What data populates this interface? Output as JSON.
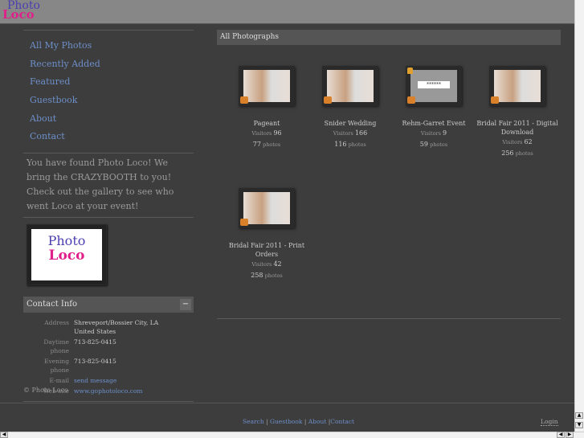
{
  "logo": {
    "line1": "Photo",
    "line2": "Loco"
  },
  "nav": [
    "All My Photos",
    "Recently Added",
    "Featured",
    "Guestbook",
    "About",
    "Contact"
  ],
  "blurb": "You have found Photo Loco! We bring the CRAZYBOOTH to you! Check out the gallery to see who went Loco at your event!",
  "contact": {
    "title": "Contact Info",
    "collapse": "−",
    "rows": [
      {
        "k": "Address",
        "v": "Shreveport/Bossier City, LA",
        "v2": "United States"
      },
      {
        "k": "Daytime phone",
        "v": "713-825-0415"
      },
      {
        "k": "Evening phone",
        "v": "713-825-0415"
      },
      {
        "k": "E-mail",
        "v": "send message"
      },
      {
        "k": "Web site",
        "v": "www.gophotoloco.com"
      }
    ]
  },
  "copyright": "© Photo Loco",
  "main": {
    "title": "All Photographs",
    "visitors_label": "Visitors",
    "photos_label": "photos",
    "albums": [
      {
        "title": "Pageant",
        "visitors": "96",
        "photos": "77",
        "locked": false
      },
      {
        "title": "Snider Wedding",
        "visitors": "166",
        "photos": "116",
        "locked": false
      },
      {
        "title": "Rehm-Garret Event",
        "visitors": "9",
        "photos": "59",
        "locked": true
      },
      {
        "title": "Bridal Fair 2011 - Digital Download",
        "visitors": "62",
        "photos": "256",
        "locked": false
      },
      {
        "title": "Bridal Fair 2011 - Print Orders",
        "visitors": "42",
        "photos": "258",
        "locked": false
      }
    ]
  },
  "footer": {
    "links": [
      "Search",
      "Guestbook",
      "About",
      "Contact"
    ],
    "login": "Login"
  }
}
